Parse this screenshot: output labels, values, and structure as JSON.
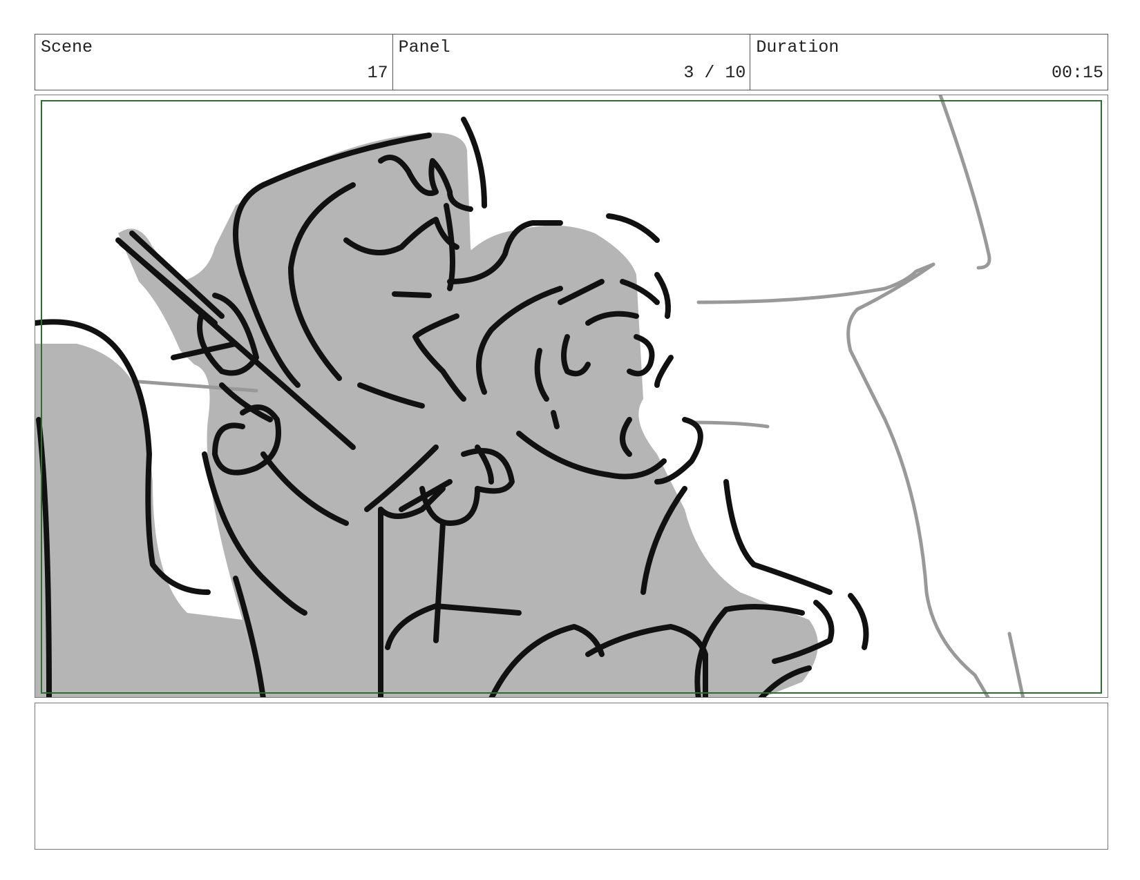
{
  "header": {
    "scene": {
      "label": "Scene",
      "value": "17"
    },
    "panel": {
      "label": "Panel",
      "value": "3 / 10"
    },
    "duration": {
      "label": "Duration",
      "value": "00:15"
    }
  },
  "colors": {
    "safe_frame": "#2e6b2e",
    "ink": "#111111",
    "tone": "#b5b5b5",
    "pencil": "#999999"
  },
  "notes": {
    "text": ""
  }
}
